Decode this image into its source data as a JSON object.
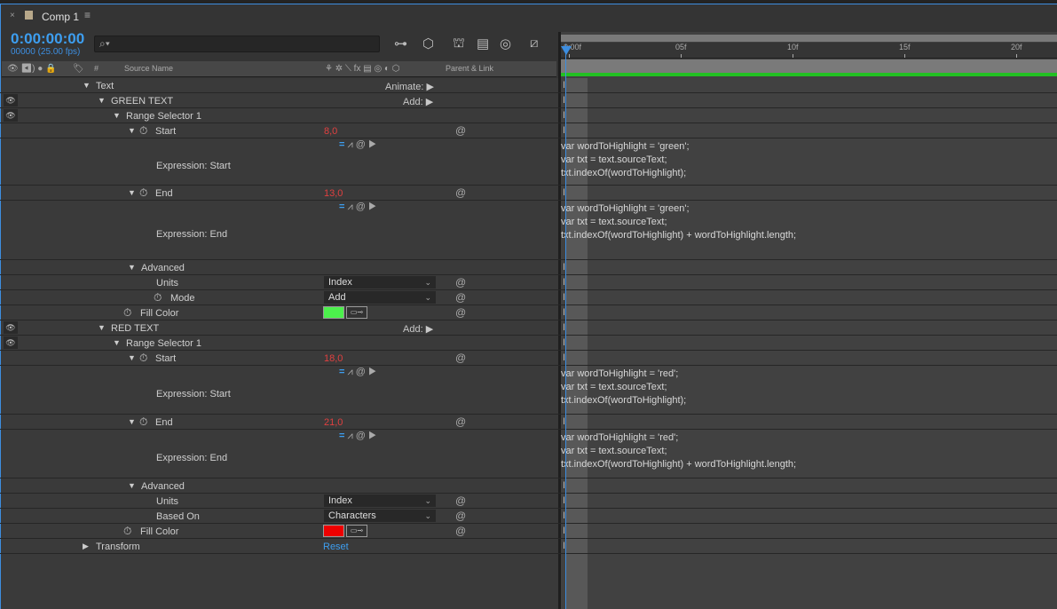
{
  "tab": {
    "title": "Comp 1",
    "close": "×",
    "menu": "≡"
  },
  "timecode": "0:00:00:00",
  "fps": "00000 (25.00 fps)",
  "search": {
    "icon": "⌕▾"
  },
  "toolbar": [
    "composition-flowchart-icon",
    "draft-3d-icon",
    "shy-layers-icon",
    "frame-blending-icon",
    "motion-blur-icon",
    "graph-editor-icon"
  ],
  "columns": {
    "num": "#",
    "source": "Source Name",
    "parent": "Parent & Link"
  },
  "ruler": [
    "0:00f",
    "05f",
    "10f",
    "15f",
    "20f"
  ],
  "colors": {
    "accent": "#3d9ef0",
    "value": "#e04040",
    "green_fill": "#4cf04c",
    "red_fill": "#ee0000",
    "work_area_bar": "#22c022"
  },
  "rows": [
    {
      "kind": "group",
      "label": "Text",
      "action": "Animate:"
    },
    {
      "kind": "group",
      "label": "GREEN TEXT",
      "eye": true,
      "action": "Add:"
    },
    {
      "kind": "group",
      "label": "Range Selector 1",
      "eye": true
    },
    {
      "kind": "prop",
      "label": "Start",
      "value": "8,0",
      "stopwatch": true,
      "tri": true
    },
    {
      "kind": "expr",
      "label": "Expression: Start",
      "code": "var wordToHighlight = 'green';\nvar txt = text.sourceText;\ntxt.indexOf(wordToHighlight);"
    },
    {
      "kind": "prop",
      "label": "End",
      "value": "13,0",
      "stopwatch": true,
      "tri": true
    },
    {
      "kind": "expr",
      "label": "Expression: End",
      "code": "var wordToHighlight = 'green';\nvar txt = text.sourceText;\ntxt.indexOf(wordToHighlight) + wordToHighlight.length;"
    },
    {
      "kind": "group",
      "label": "Advanced"
    },
    {
      "kind": "dropdown",
      "label": "Units",
      "value": "Index"
    },
    {
      "kind": "dropdown",
      "label": "Mode",
      "value": "Add",
      "stopwatch": true
    },
    {
      "kind": "color",
      "label": "Fill Color",
      "color": "#4cf04c"
    },
    {
      "kind": "group",
      "label": "RED TEXT",
      "eye": true,
      "action": "Add:"
    },
    {
      "kind": "group",
      "label": "Range Selector 1",
      "eye": true
    },
    {
      "kind": "prop",
      "label": "Start",
      "value": "18,0",
      "stopwatch": true,
      "tri": true
    },
    {
      "kind": "expr",
      "label": "Expression: Start",
      "code": "var wordToHighlight = 'red';\nvar txt = text.sourceText;\ntxt.indexOf(wordToHighlight);"
    },
    {
      "kind": "prop",
      "label": "End",
      "value": "21,0",
      "stopwatch": true,
      "tri": true
    },
    {
      "kind": "expr",
      "label": "Expression: End",
      "code": "var wordToHighlight = 'red';\nvar txt = text.sourceText;\ntxt.indexOf(wordToHighlight) + wordToHighlight.length;"
    },
    {
      "kind": "group",
      "label": "Advanced"
    },
    {
      "kind": "dropdown",
      "label": "Units",
      "value": "Index"
    },
    {
      "kind": "dropdown",
      "label": "Based On",
      "value": "Characters"
    },
    {
      "kind": "color",
      "label": "Fill Color",
      "color": "#ee0000"
    },
    {
      "kind": "transform",
      "label": "Transform",
      "action": "Reset"
    }
  ]
}
